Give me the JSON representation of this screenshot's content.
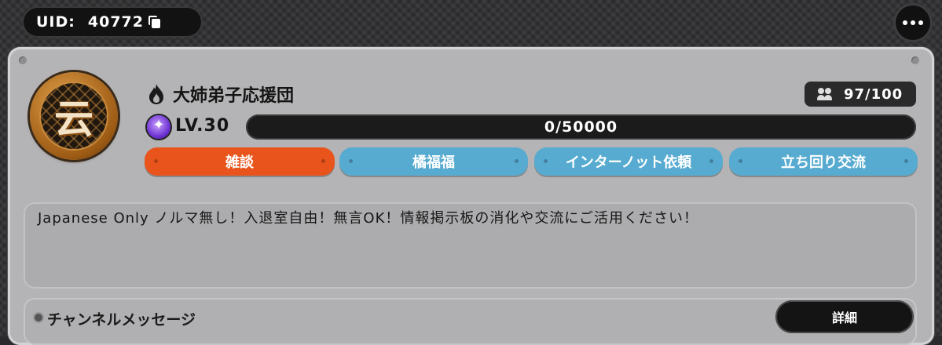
{
  "header": {
    "uid_label": "UID:",
    "uid_value": "40772",
    "copy_icon": "copy-icon",
    "more_icon": "more-dots-icon"
  },
  "club": {
    "emblem_char": "云",
    "attribute_icon": "fire-flame-icon",
    "name": "大姉弟子応援団",
    "members": "97/100",
    "members_icon": "people-icon",
    "level_icon": "level-star-icon",
    "level": "LV.30",
    "exp": "0/50000",
    "tags": [
      {
        "label": "雑談",
        "color": "#e8541c"
      },
      {
        "label": "橘福福",
        "color": "#58abd0"
      },
      {
        "label": "インターノット依頼",
        "color": "#58abd0"
      },
      {
        "label": "立ち回り交流",
        "color": "#58abd0"
      }
    ],
    "description": "Japanese Only ノルマ無し！入退室自由！無言OK！情報掲示板の消化や交流にご活用ください！"
  },
  "channel": {
    "label": "チャンネルメッセージ",
    "detail_button": "詳細"
  }
}
